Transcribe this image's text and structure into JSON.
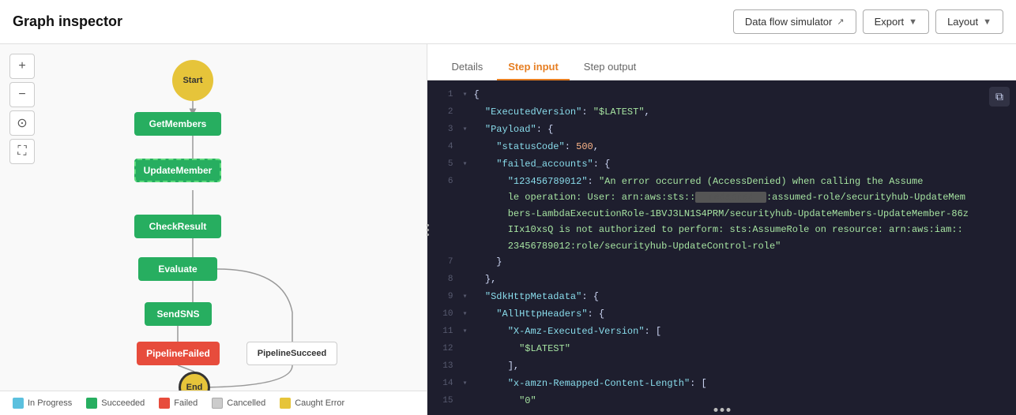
{
  "header": {
    "title": "Graph inspector",
    "buttons": {
      "data_flow_simulator": "Data flow simulator",
      "export": "Export",
      "layout": "Layout"
    }
  },
  "tabs": {
    "details": "Details",
    "step_input": "Step input",
    "step_output": "Step output",
    "active": "step_input"
  },
  "toolbar": {
    "zoom_in": "+",
    "zoom_out": "−",
    "target": "⊙",
    "fullscreen": "⛶"
  },
  "graph": {
    "nodes": {
      "start": "Start",
      "get_members": "GetMembers",
      "update_member": "UpdateMember",
      "check_result": "CheckResult",
      "evaluate": "Evaluate",
      "send_sns": "SendSNS",
      "pipeline_failed": "PipelineFailed",
      "pipeline_succeed": "PipelineSucceed",
      "end": "End"
    }
  },
  "legend": {
    "in_progress": "In Progress",
    "succeeded": "Succeeded",
    "failed": "Failed",
    "cancelled": "Cancelled",
    "caught_error": "Caught Error"
  },
  "code": {
    "lines": [
      {
        "num": 1,
        "arrow": "▾",
        "content": "{",
        "type": "punct"
      },
      {
        "num": 2,
        "arrow": " ",
        "content": "  \"ExecutedVersion\": \"$LATEST\",",
        "keys": [
          "ExecutedVersion"
        ],
        "vals": [
          "$LATEST"
        ]
      },
      {
        "num": 3,
        "arrow": "▾",
        "content": "  \"Payload\": {",
        "keys": [
          "Payload"
        ]
      },
      {
        "num": 4,
        "arrow": " ",
        "content": "    \"statusCode\": 500,",
        "keys": [
          "statusCode"
        ],
        "vals": [
          "500"
        ]
      },
      {
        "num": 5,
        "arrow": "▾",
        "content": "    \"failed_accounts\": {",
        "keys": [
          "failed_accounts"
        ]
      },
      {
        "num": 6,
        "arrow": " ",
        "content": "      \"123456789012\": \"An error occurred (AccessDenied) when calling the AssumeRole operation: User: arn:aws:sts::           :assumed-role/securityhub-UpdateMembers-LambdaExecutionRole-1BVJ3LN1S4PRM/securityhub-UpdateMembers-UpdateMember-86zIIx10xsQ is not authorized to perform: sts:AssumeRole on resource: arn:aws:iam::23456789012:role/securityhub-UpdateControl-role\"",
        "keys": [
          "123456789012"
        ]
      },
      {
        "num": 7,
        "arrow": " ",
        "content": "    }",
        "type": "punct"
      },
      {
        "num": 8,
        "arrow": " ",
        "content": "  },",
        "type": "punct"
      },
      {
        "num": 9,
        "arrow": "▾",
        "content": "  \"SdkHttpMetadata\": {",
        "keys": [
          "SdkHttpMetadata"
        ]
      },
      {
        "num": 10,
        "arrow": "▾",
        "content": "    \"AllHttpHeaders\": {",
        "keys": [
          "AllHttpHeaders"
        ]
      },
      {
        "num": 11,
        "arrow": "▾",
        "content": "      \"X-Amz-Executed-Version\": [",
        "keys": [
          "X-Amz-Executed-Version"
        ]
      },
      {
        "num": 12,
        "arrow": " ",
        "content": "        \"$LATEST\"",
        "vals": [
          "$LATEST"
        ]
      },
      {
        "num": 13,
        "arrow": " ",
        "content": "      ],",
        "type": "punct"
      },
      {
        "num": 14,
        "arrow": "▾",
        "content": "      \"x-amzn-Remapped-Content-Length\": [",
        "keys": [
          "x-amzn-Remapped-Content-Length"
        ]
      },
      {
        "num": 15,
        "arrow": " ",
        "content": "        \"0\"",
        "vals": [
          "0"
        ]
      }
    ]
  }
}
